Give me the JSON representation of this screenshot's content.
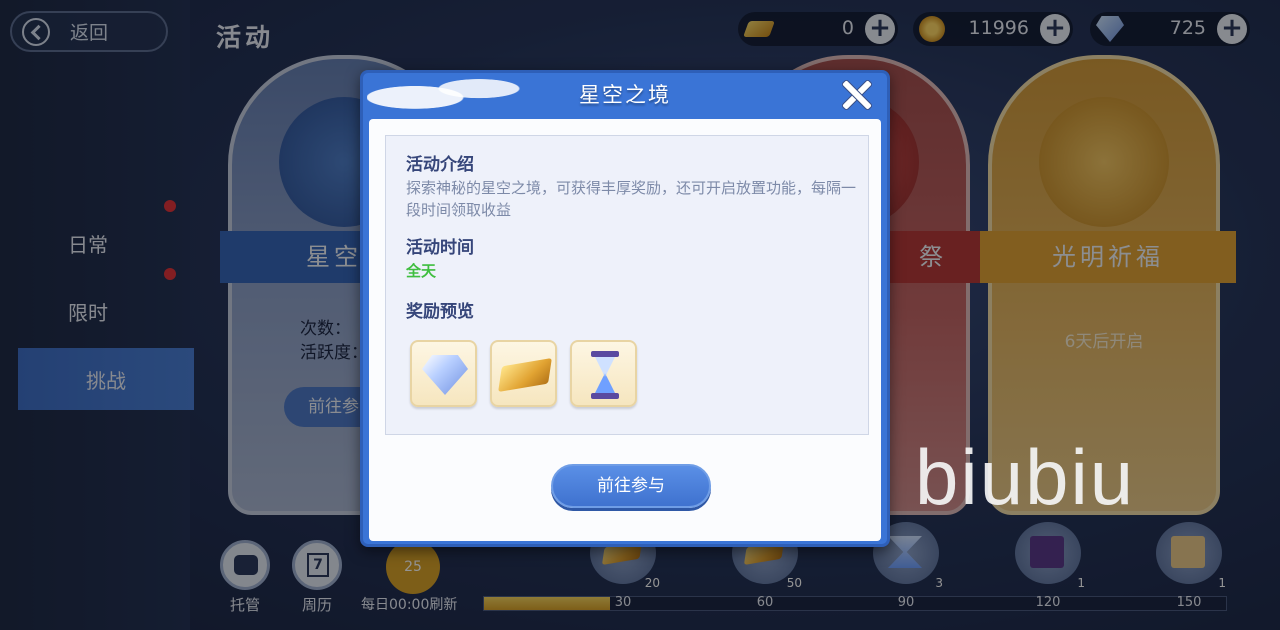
{
  "header": {
    "back_label": "返回",
    "title": "活动",
    "currencies": [
      {
        "icon": "gold-bar-icon",
        "value": "0"
      },
      {
        "icon": "gold-coin-icon",
        "value": "11996"
      },
      {
        "icon": "diamond-icon",
        "value": "725"
      }
    ]
  },
  "sidebar": {
    "tabs": [
      {
        "label": "日常",
        "has_dot": true
      },
      {
        "label": "限时",
        "has_dot": true
      },
      {
        "label": "挑战",
        "active": true
      }
    ]
  },
  "cards": {
    "card1": {
      "ribbon": "星空之",
      "info_line1": "次数：",
      "info_line2": "活跃度：",
      "button": "前往参"
    },
    "card3": {
      "ribbon": "祭"
    },
    "card4": {
      "ribbon": "光明祈福",
      "status": "6天后开启"
    }
  },
  "bottom": {
    "auto_label": "托管",
    "calendar_label": "周历",
    "calendar_day": "7",
    "activity_points": "25",
    "refresh_label": "每日00:00刷新",
    "progress": 0.17,
    "milestones": [
      "30",
      "60",
      "90",
      "120",
      "150"
    ],
    "reward_counts": [
      "20",
      "50",
      "3",
      "1",
      "1"
    ]
  },
  "modal": {
    "title": "星空之境",
    "intro_title": "活动介绍",
    "intro_text": "探索神秘的星空之境，可获得丰厚奖励，还可开启放置功能，每隔一段时间领取收益",
    "time_title": "活动时间",
    "time_value": "全天",
    "reward_title": "奖励预览",
    "rewards": [
      "diamond-icon",
      "gold-bar-icon",
      "hourglass-icon"
    ],
    "button": "前往参与"
  },
  "watermark": "biubiu"
}
